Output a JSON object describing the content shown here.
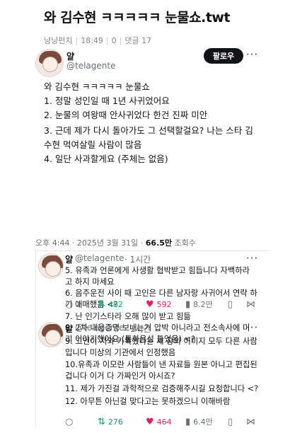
{
  "post": {
    "title": "와 김수현 ㅋㅋㅋㅋㅋ 눈물쇼.twt",
    "board": "냥냥펀치",
    "time": "18:49",
    "likes": "0",
    "comments_label": "댓글 17"
  },
  "tweet": {
    "name": "얄",
    "handle": "@telagente",
    "follow_label": "팔로우",
    "more": "···",
    "lines": [
      "와 김수현 ㅋㅋㅋㅋㅋ 눈물쇼",
      "1. 정말 성인일 때 1년 사귀었어요",
      "2. 눈물의 여왕때 안사귀었다 한건 진짜 미안",
      "3. 근데 제가 다시 돌아가도 그 선택할걸요? 나는 스타 김",
      "수현 먹여살릴 사람이 많음",
      "4. 일단 사과할게요 (주체는 없음)"
    ],
    "stamp_prefix": "오후 4:44 · 2025년 3월 31일 · ",
    "views_count": "66.5만",
    "views_suffix": " 조회수"
  },
  "replies": [
    {
      "name": "얄",
      "handle": "@telagente",
      "age": "· 1시간",
      "more": "···",
      "lines": [
        "5. 유족과 언론에게 사생활 협박받고 힘듭니다 자백하라",
        "고 하지 마세요",
        "6. 음주운전 사이 때 고인은 다른 남자랑 사귀어서 연락 하",
        "기 애매했음 <?",
        "7. 난 인기스타라 오해 많이 받고 힘듦",
        "8. 2차 내용증명 보내는거 압박 아니라고 전소속사에 미",
        "리 이야기했어요 (통화음성 틀었음) <?"
      ],
      "stats": {
        "replies": "1",
        "retweets": "482",
        "likes": "592",
        "views": "8.2만"
      }
    },
    {
      "name": "얄",
      "handle": "@telagente",
      "age": "· 1시간",
      "more": "···",
      "lines": [
        "9. 고인이 저와 카톡했다는 세 장의 이미지 모두 다른 사람",
        "입니다 미상의 기관에서 인정했음",
        "10.유족과 이모란 사람들이 낸 자료들 원본 아니고 편집된",
        "겁니다 이거 다 가짜인거 아시죠?",
        "11. 제가 가진걸 과학적으로 검증해주시길 요청합니다 <?",
        "12. 아무튼 아닌걸 맞다고는 못하겠으니 이해바람"
      ],
      "stats": {
        "replies": "",
        "retweets": "276",
        "likes": "464",
        "views": "6.4만"
      }
    }
  ],
  "icons": {
    "reply": "speech-bubble-icon",
    "retweet": "retweet-icon",
    "like": "heart-icon",
    "views": "bar-chart-icon",
    "bookmark": "bookmark-icon",
    "share": "share-icon"
  },
  "colors": {
    "retweet": "#00a36b",
    "like": "#e0245e",
    "follow_bg": "#0f1419",
    "muted": "#6b7075"
  }
}
